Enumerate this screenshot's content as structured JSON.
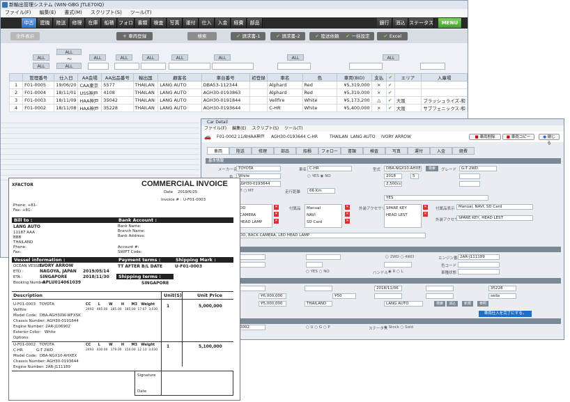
{
  "main": {
    "title": "新輸出管理システム (WIN-GBG JTLE70IQ)",
    "menu": [
      "ファイル(F)",
      "編集(E)",
      "書式(M)",
      "スクリプト(S)",
      "ツール(T)"
    ],
    "nav": [
      "中古",
      "建機",
      "陸送",
      "修理",
      "在庫",
      "船積",
      "フォロー",
      "書類",
      "検査",
      "写真",
      "運付",
      "仕入",
      "入金",
      "経費",
      "部品",
      "銀行",
      "消込",
      "ステータス",
      "MENU"
    ],
    "toolbar": {
      "all_show": "全件表示",
      "register": "車両登録",
      "search": "検索",
      "invoice1": "請求書-1",
      "invoice2": "請求書-2",
      "land": "陸送依頼",
      "bulk": "一括設定",
      "excel": "Excel"
    },
    "filter_all": "ALL",
    "filter_range": "～",
    "columns": [
      "",
      "管理番号",
      "仕入日",
      "AA会場",
      "AA出品番号",
      "輸出国",
      "顧客名",
      "車台番号",
      "初登録",
      "車名",
      "色",
      "車両(BID)",
      "支払",
      "",
      "エリア",
      "入庫場"
    ],
    "rows": [
      [
        "1",
        "F01-0005",
        "19/06/20",
        "CAA東京",
        "5577",
        "THAILAN",
        "LANG AUTO",
        "DBA53-112344",
        "",
        "Alphard",
        "Red",
        "¥5,319,000",
        "×",
        "✔",
        "",
        ""
      ],
      [
        "2",
        "F01-0004",
        "18/11/01",
        "USS神戸",
        "4108",
        "THAILAN",
        "LANG AUTO",
        "AGH30-0193863",
        "",
        "Alphard",
        "Red",
        "¥5,319,000",
        "×",
        "✔",
        "",
        ""
      ],
      [
        "3",
        "F01-0003",
        "18/11/09",
        "HAA神戸",
        "35042",
        "THAILAN",
        "LANG AUTO",
        "AGH30-0191844",
        "",
        "Vellfire",
        "White",
        "¥5,173,200",
        "△",
        "✔",
        "大阪",
        "ブラッシュライズ-和"
      ],
      [
        "4",
        "F01-0002",
        "18/11/08",
        "HAA神戸",
        "35228",
        "THAILAN",
        "LANG AUTO",
        "AGH30-0193644",
        "",
        "C-HR",
        "White",
        "¥5,400,000",
        "×",
        "✔",
        "大阪",
        "サブフェニックス-和"
      ]
    ]
  },
  "detail": {
    "title": "Car Detail",
    "menu": [
      "ファイル(F)",
      "編集(E)",
      "スクリプト(S)",
      "ツール(T)"
    ],
    "header": [
      "F01-0002",
      "11/8",
      "HAA神戸",
      "AGH30-0193644",
      "C-HR",
      "THAILAN",
      "LANG AUTO",
      "IVORY ARROW"
    ],
    "buttons": [
      "車両削除",
      "車両コピー",
      "閉じる"
    ],
    "tabs": [
      "車両",
      "陸送",
      "修理",
      "部品",
      "船積",
      "フォロー",
      "書類",
      "検査",
      "写真",
      "運付",
      "入金",
      "経費"
    ],
    "section_basic": "基本情報",
    "maker_label": "メーカー名",
    "maker": "TOYOTA",
    "carname_label": "車名",
    "carname": "C-HR",
    "model_label": "型式",
    "model": "DBA-NGX10-AHXEX",
    "grade_label": "グレード",
    "grade": "G-T 2WD",
    "color_label": "色",
    "color": "White",
    "year": "2018",
    "month": "5",
    "displacement": "2,500cc",
    "chassis": "AGH30-0193644",
    "mileage_label": "走行距離",
    "mileage": "66 Km",
    "yes": "YES",
    "no": "NO",
    "at": "AT",
    "mt": "MT",
    "opt1": [
      "DD",
      "CAMERA",
      "HEAD LAMP"
    ],
    "acc_label": "付属品",
    "acc": [
      "Manual",
      "NAVI",
      "SD Card"
    ],
    "ext_label": "外装アクセサリ",
    "ext": [
      "SPARE KEY",
      "HEAD LEST"
    ],
    "acc_summary_label": "付属品表示",
    "acc_summary": "Manual, NAVI, SD Card",
    "ext_summary_label": "外装アクセサリ",
    "ext_summary": "SPARE KEY, HEAD LEST",
    "equip_summary": "DD, BACK CAMERA, LED HEAD LAMP",
    "drive_2wd": "2WD",
    "drive_4wd": "4WD",
    "engine_label": "エンジン番号",
    "engine": "2AR-J111189",
    "color_code_label": "色コード",
    "maker_code_label": "車種状態",
    "handle_label": "ハンドル",
    "handle_r": "R",
    "handle_l": "L",
    "price1": "¥6,000,000",
    "price2": "¥5,000,000",
    "price3": "¥50",
    "aa_date": "2018/11/06",
    "country": "THAILAND",
    "customer": "LANG AUTO",
    "aa_no": "35228",
    "aa_site": "seda",
    "sold_btn": "車両仕入を完了にする。",
    "stock_label": "ステータス",
    "stock": "Stock",
    "sold": "Sold",
    "bottom_id": "0002"
  },
  "invoice": {
    "company": "XFACTOR",
    "title": "COMMERCIAL INVOICE",
    "date_label": "Date",
    "date": "2019/6/25",
    "invoice_label": "Invoice # :",
    "invoice_no": "U-F01-0003",
    "phone": "Phone: +81-",
    "fax": "Fax:    +81-",
    "bill_to": "Bill to :",
    "bank": "Bank Account :",
    "customer": "LANG AUTO",
    "addr": [
      "11187 AAA",
      "BBB",
      "THAILAND"
    ],
    "cust_phone": "Phone:",
    "cust_fax": "Fax:",
    "bank_fields": [
      "Bank Name:",
      "Branch Name:",
      "Bank Address:",
      "Account #:",
      "SWIFT Code:"
    ],
    "vessel_info": "Vessel information :",
    "payment_terms": "Payment terms :",
    "shipping_mark": "Shipping Mark :",
    "vessel_label": "OCEAN VESSEL :",
    "vessel": "IVORY ARROW",
    "etd_label": "ETD :",
    "etd_port": "NAGOYA, JAPAN",
    "etd_date": "2019/05/14",
    "eta_label": "ETA :",
    "eta_port": "SINGAPORE",
    "eta_date": "2018/11/30",
    "booking_label": "Booking Number",
    "booking": "APLU014061039",
    "payment_value": "TT AFTER B/L DATE",
    "mark_value": "U-F01-0003",
    "shipping_terms": "Shipping terms :",
    "shipping_value": "SINGAPORE",
    "desc_header": "Description",
    "unit_header": "Unit(S)",
    "price_header": "Unit Price",
    "dim_headers": [
      "CC",
      "L",
      "W",
      "H",
      "M3",
      "Weight"
    ],
    "items": [
      {
        "id": "U-F01-0003",
        "maker": "TOYOTA",
        "name": "Vellfire",
        "model": "DBA-AGH30W-WFXSK",
        "chassis": "AGH30-0191844",
        "engine": "2AR-J106902",
        "color": "White",
        "dims": [
          "2493",
          "495.00",
          "185.00",
          "185.00",
          "17.67",
          "3,030"
        ],
        "unit": "1",
        "price": "5,000,000"
      },
      {
        "id": "U-F01-0002",
        "maker": "TOYOTA",
        "name": "C-HR",
        "grade": "G-T 2WD",
        "model": "DBA-NGX10-AHXEX",
        "chassis": "AGH30-0193644",
        "engine": "2AR-J111189",
        "dims": [
          "2493",
          "430.00",
          "179.00",
          "150.00",
          "12.13",
          "3,030"
        ],
        "unit": "1",
        "price": "5,100,000"
      }
    ],
    "model_label": "Model Code:",
    "chassis_label": "Chassis Number:",
    "engine_label": "Engine Number:",
    "color_label": "Exterior Color:",
    "options_label": "Options:",
    "signature": "Signature",
    "sig_date": "Date"
  }
}
